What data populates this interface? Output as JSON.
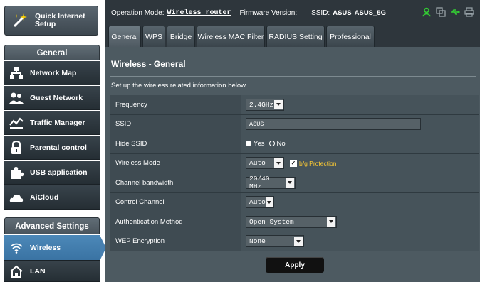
{
  "sidebar": {
    "quick_setup": "Quick Internet Setup",
    "general_header": "General",
    "items": [
      {
        "label": "Network Map"
      },
      {
        "label": "Guest Network"
      },
      {
        "label": "Traffic Manager"
      },
      {
        "label": "Parental control"
      },
      {
        "label": "USB application"
      },
      {
        "label": "AiCloud"
      }
    ],
    "advanced_header": "Advanced Settings",
    "advanced_items": [
      {
        "label": "Wireless"
      },
      {
        "label": "LAN"
      }
    ],
    "active_color": "#4a84b4"
  },
  "topbar": {
    "operation_mode_label": "Operation Mode:",
    "operation_mode_value": "Wireless router",
    "firmware_label": "Firmware Version:",
    "ssid_label": "SSID:",
    "ssid_1": "ASUS",
    "ssid_2": "ASUS_5G",
    "status_icons": [
      "user-icon",
      "copy-icon",
      "usb-icon",
      "printer-icon"
    ]
  },
  "tabs": [
    "General",
    "WPS",
    "Bridge",
    "Wireless MAC Filter",
    "RADIUS Setting",
    "Professional"
  ],
  "main": {
    "title": "Wireless - General",
    "description": "Set up the wireless related information below.",
    "fields": {
      "frequency": {
        "label": "Frequency",
        "value": "2.4GHz"
      },
      "ssid": {
        "label": "SSID",
        "value": "ASUS"
      },
      "hide_ssid": {
        "label": "Hide SSID",
        "yes": "Yes",
        "no": "No"
      },
      "wireless_mode": {
        "label": "Wireless Mode",
        "value": "Auto",
        "protection_label": "b/g Protection"
      },
      "channel_bandwidth": {
        "label": "Channel bandwidth",
        "value": "20/40 MHz"
      },
      "control_channel": {
        "label": "Control Channel",
        "value": "Auto"
      },
      "auth_method": {
        "label": "Authentication Method",
        "value": "Open System"
      },
      "wep_encryption": {
        "label": "WEP Encryption",
        "value": "None"
      }
    },
    "apply_label": "Apply"
  }
}
